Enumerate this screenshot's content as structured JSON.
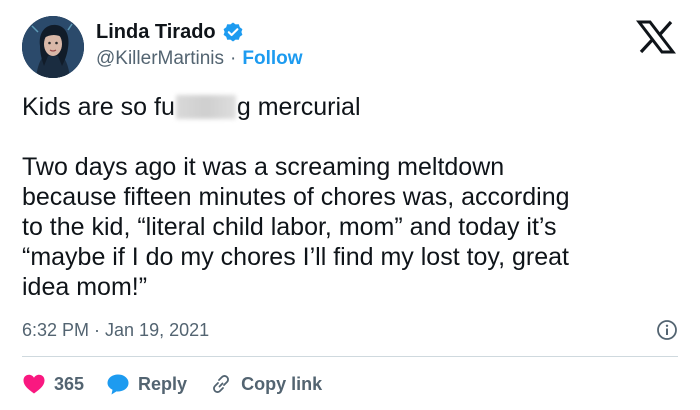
{
  "colors": {
    "accent": "#1d9bf0",
    "text_primary": "#0f1419",
    "text_secondary": "#536471",
    "heart": "#f91880",
    "divider": "#cfd9de"
  },
  "author": {
    "display_name": "Linda Tirado",
    "handle": "@KillerMartinis",
    "separator": "·",
    "follow_label": "Follow",
    "verified_icon": "verified-badge-icon",
    "avatar_icon": "avatar-illustration"
  },
  "platform_icon": "x-logo-icon",
  "tweet": {
    "line1_before": "Kids are so fu",
    "line1_after": "g mercurial",
    "paragraph_lines": [
      "Two days ago it was a screaming meltdown",
      "because fifteen minutes of chores was, according",
      "to the kid, “literal child labor, mom” and today it’s",
      "“maybe if I do my chores I’ll find my lost toy, great",
      "idea mom!”"
    ]
  },
  "meta": {
    "timestamp": "6:32 PM · Jan 19, 2021",
    "info_icon": "info-icon"
  },
  "actions": {
    "like_count": "365",
    "reply_label": "Reply",
    "copy_link_label": "Copy link"
  }
}
